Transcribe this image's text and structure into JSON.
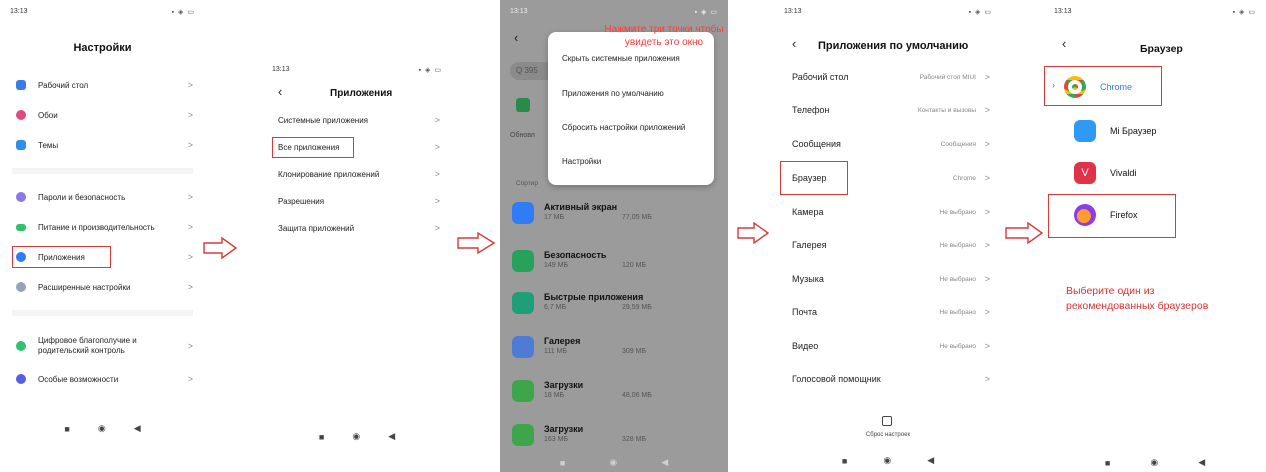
{
  "colors": {
    "red": "#e03030",
    "blue": "#2f7cf6"
  },
  "screen1": {
    "time": "13:13",
    "title": "Настройки",
    "items": [
      {
        "label": "Рабочий стол",
        "icon": "home-icon"
      },
      {
        "label": "Обои",
        "icon": "flower-icon"
      },
      {
        "label": "Темы",
        "icon": "brush-icon"
      },
      {
        "label": "Пароли и безопасность",
        "icon": "fingerprint-icon"
      },
      {
        "label": "Питание и производительность",
        "icon": "battery-icon"
      },
      {
        "label": "Приложения",
        "icon": "gear-icon"
      },
      {
        "label": "Расширенные настройки",
        "icon": "more-icon"
      },
      {
        "label": "Цифровое благополучие и родительский контроль",
        "icon": "person-icon"
      },
      {
        "label": "Особые возможности",
        "icon": "accessibility-icon"
      }
    ]
  },
  "screen2": {
    "time": "13:13",
    "title": "Приложения",
    "items": [
      {
        "label": "Системные приложения"
      },
      {
        "label": "Все приложения"
      },
      {
        "label": "Клонирование приложений"
      },
      {
        "label": "Разрешения"
      },
      {
        "label": "Защита приложений"
      }
    ]
  },
  "screen3": {
    "time": "13:13",
    "search_prefix": "Q 395",
    "update_label": "Обновл",
    "sort_label": "Сортир",
    "hint": "Нажмите три точки чтобы увидеть это окно",
    "menu": [
      {
        "label": "Скрыть системные приложения"
      },
      {
        "label": "Приложения по умолчанию"
      },
      {
        "label": "Сбросить настройки приложений"
      },
      {
        "label": "Настройки"
      }
    ],
    "apps": [
      {
        "name": "Активный экран",
        "size1": "17 МБ",
        "size2": "77,05 МБ",
        "color": "#2f7cf6"
      },
      {
        "name": "Безопасность",
        "size1": "149 МБ",
        "size2": "120 МБ",
        "color": "#26a25b"
      },
      {
        "name": "Быстрые приложения",
        "size1": "6,7 МБ",
        "size2": "29,59 МБ",
        "color": "#1f9e7a"
      },
      {
        "name": "Галерея",
        "size1": "111 МБ",
        "size2": "309 МБ",
        "color": "#4f7bd6"
      },
      {
        "name": "Загрузки",
        "size1": "18 МБ",
        "size2": "48,06 МБ",
        "color": "#3ea54a"
      },
      {
        "name": "Загрузки",
        "size1": "163 МБ",
        "size2": "328 МБ",
        "color": "#3ea54a"
      }
    ]
  },
  "screen4": {
    "time": "13:13",
    "title": "Приложения по умолчанию",
    "items": [
      {
        "label": "Рабочий стол",
        "value": "Рабочий стол MIUI"
      },
      {
        "label": "Телефон",
        "value": "Контакты и вызовы"
      },
      {
        "label": "Сообщения",
        "value": "Сообщения"
      },
      {
        "label": "Браузер",
        "value": "Chrome"
      },
      {
        "label": "Камера",
        "value": "Не выбрано"
      },
      {
        "label": "Галерея",
        "value": "Не выбрано"
      },
      {
        "label": "Музыка",
        "value": "Не выбрано"
      },
      {
        "label": "Почта",
        "value": "Не выбрано"
      },
      {
        "label": "Видео",
        "value": "Не выбрано"
      },
      {
        "label": "Голосовой помощник",
        "value": ""
      }
    ],
    "reset_label": "Сброс настроек"
  },
  "screen5": {
    "time": "13:13",
    "title": "Браузер",
    "browsers": [
      {
        "name": "Chrome",
        "selected": true
      },
      {
        "name": "Mi Браузер",
        "selected": false
      },
      {
        "name": "Vivaldi",
        "selected": false
      },
      {
        "name": "Firefox",
        "selected": false
      }
    ],
    "note": "Выберите один из рекомендованных браузеров"
  }
}
